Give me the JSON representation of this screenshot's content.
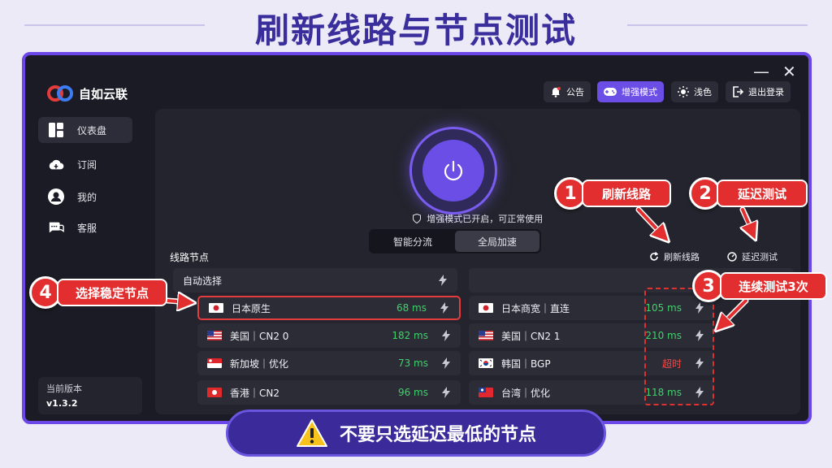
{
  "heading": "刷新线路与节点测试",
  "app": {
    "name": "自如云联",
    "nav": [
      {
        "label": "仪表盘",
        "icon": "dashboard-icon",
        "active": true
      },
      {
        "label": "订阅",
        "icon": "cloud-icon",
        "active": false
      },
      {
        "label": "我的",
        "icon": "user-icon",
        "active": false
      },
      {
        "label": "客服",
        "icon": "chat-icon",
        "active": false
      }
    ],
    "version_label": "当前版本",
    "version": "v1.3.2",
    "toolbar": {
      "announcement": "公告",
      "enhanced_mode": "增强模式",
      "theme": "浅色",
      "logout": "退出登录"
    },
    "window_controls": {
      "minimize": "—",
      "close": "✕"
    },
    "status_text": "增强模式已开启，可正常使用",
    "routing_modes": [
      "智能分流",
      "全局加速"
    ],
    "active_mode": "全局加速",
    "section_title": "线路节点",
    "refresh_label": "刷新线路",
    "latency_test_label": "延迟测试",
    "auto_select": "自动选择",
    "left_nodes": [
      {
        "flag": "jp",
        "name": "日本原生",
        "latency": "68 ms",
        "status": "green"
      },
      {
        "flag": "us",
        "name": "美国｜CN2 0",
        "latency": "182 ms",
        "status": "green"
      },
      {
        "flag": "sg",
        "name": "新加坡｜优化",
        "latency": "73 ms",
        "status": "green"
      },
      {
        "flag": "hk",
        "name": "香港｜CN2",
        "latency": "96 ms",
        "status": "green"
      }
    ],
    "right_nodes": [
      {
        "flag": "jp",
        "name": "日本商宽｜直连",
        "latency": "105 ms",
        "status": "green"
      },
      {
        "flag": "us",
        "name": "美国｜CN2 1",
        "latency": "210 ms",
        "status": "green"
      },
      {
        "flag": "kr",
        "name": "韩国｜BGP",
        "latency": "超时",
        "status": "red"
      },
      {
        "flag": "tw",
        "name": "台湾｜优化",
        "latency": "118 ms",
        "status": "green"
      }
    ]
  },
  "annotations": [
    {
      "number": "1",
      "text": "刷新线路"
    },
    {
      "number": "2",
      "text": "延迟测试"
    },
    {
      "number": "3",
      "text": "连续测试3次"
    },
    {
      "number": "4",
      "text": "选择稳定节点"
    }
  ],
  "warning": "不要只选延迟最低的节点",
  "colors": {
    "accent": "#6b4ee6",
    "callout_red": "#e22e2e",
    "latency_green": "#3fd26a",
    "timeout_red": "#f04b4b"
  }
}
